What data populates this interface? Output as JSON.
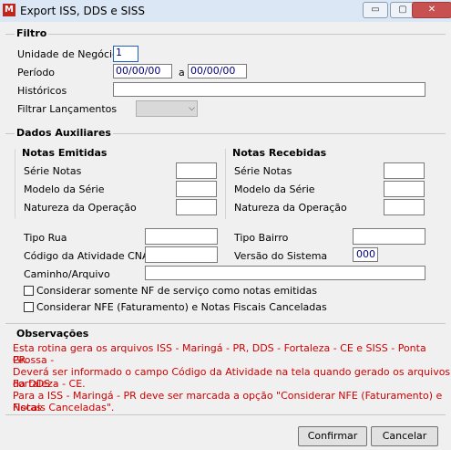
{
  "window": {
    "title": "Export ISS, DDS e SISS",
    "app_icon": "app-icon",
    "buttons": {
      "minimize": "▭",
      "maximize": "▢",
      "close": "✕"
    }
  },
  "filtro": {
    "title": "Filtro",
    "unidade_label": "Unidade de Negócio",
    "unidade_value": "1",
    "periodo_label": "Período",
    "periodo_from": "00/00/00",
    "periodo_sep": "a",
    "periodo_to": "00/00/00",
    "historicos_label": "Históricos",
    "historicos_value": "",
    "filtrar_label": "Filtrar Lançamentos",
    "filtrar_value": ""
  },
  "dados": {
    "title": "Dados Auxiliares",
    "emitidas": {
      "title": "Notas Emitidas",
      "serie_label": "Série Notas",
      "modelo_label": "Modelo da Série",
      "natureza_label": "Natureza da Operação"
    },
    "recebidas": {
      "title": "Notas Recebidas",
      "serie_label": "Série Notas",
      "modelo_label": "Modelo da Série",
      "natureza_label": "Natureza da Operação"
    },
    "tipo_rua_label": "Tipo Rua",
    "tipo_bairro_label": "Tipo Bairro",
    "cnae_label": "Código da Atividade CNAE",
    "versao_label": "Versão do Sistema",
    "versao_value": "000",
    "caminho_label": "Caminho/Arquivo",
    "chk1_label": "Considerar somente NF de serviço como notas emitidas",
    "chk2_label": "Considerar NFE (Faturamento) e Notas Fiscais Canceladas"
  },
  "observacoes": {
    "title": "Observações",
    "line1": "Esta rotina gera os arquivos ISS - Maringá - PR, DDS - Fortaleza - CE e SISS - Ponta Grossa -",
    "line2": "PR.",
    "line3": "Deverá ser informado o campo Código da Atividade na tela quando gerado os arquivos da DDS -",
    "line4": "Fortaleza - CE.",
    "line5": "Para a ISS - Maringá - PR deve ser marcada a opção \"Considerar NFE (Faturamento) e Notas",
    "line6": "Fiscais Canceladas\"."
  },
  "actions": {
    "confirm": "Confirmar",
    "cancel": "Cancelar"
  },
  "colors": {
    "obs_text": "#d00000",
    "titlebar": "#dbe7f5",
    "close": "#c75050"
  }
}
